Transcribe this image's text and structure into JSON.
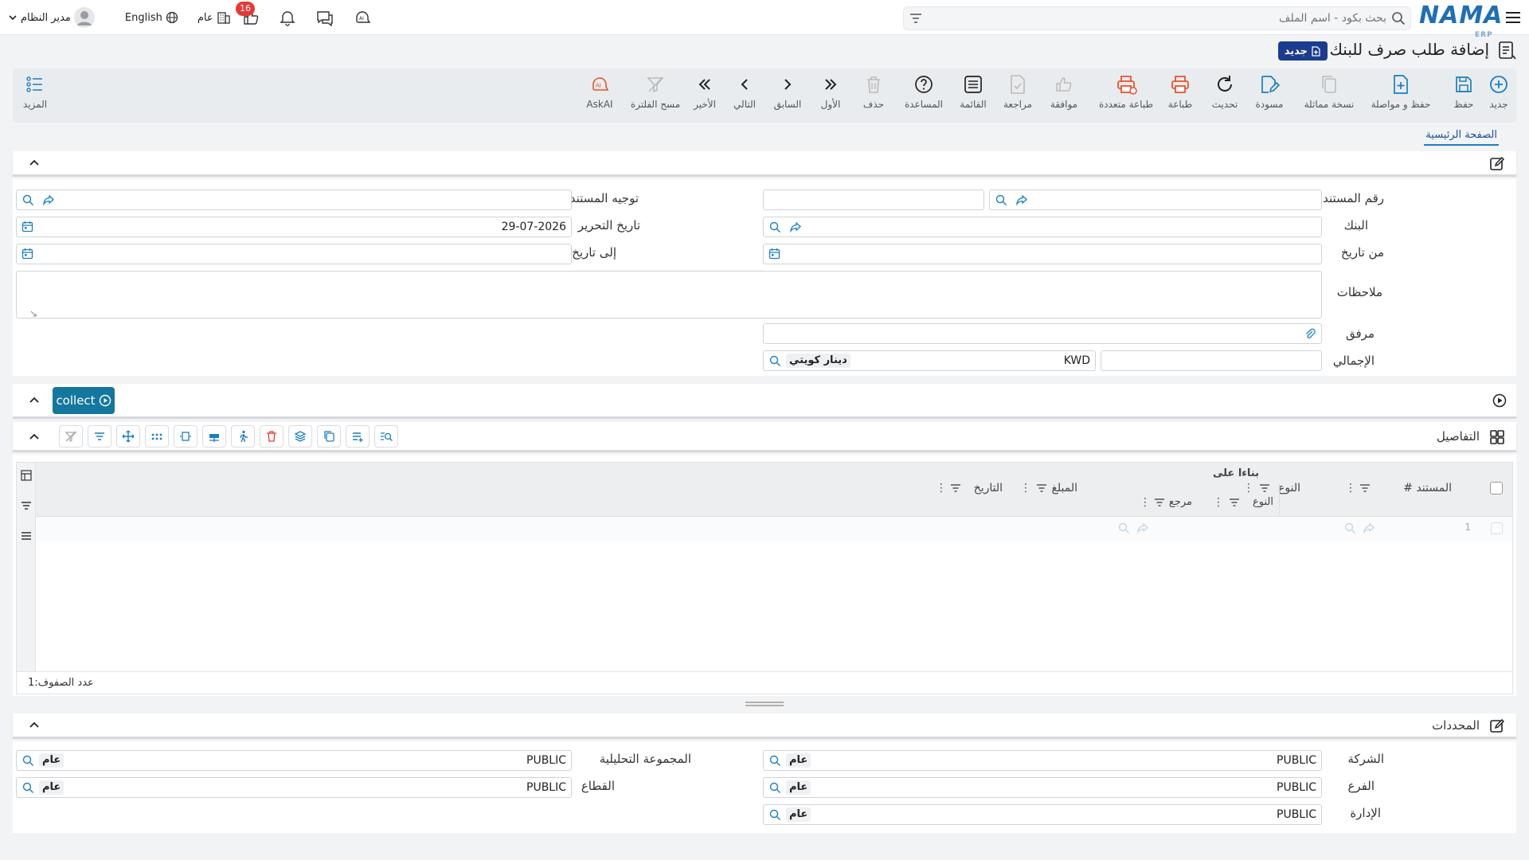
{
  "header": {
    "logo": "NAMA",
    "logo_sub": "ERP",
    "search_placeholder": "بحث بكود - اسم الملف",
    "user_name": "مدير النظام",
    "language": "English",
    "scope": "عام",
    "notification_count": "16"
  },
  "page": {
    "title": "إضافة طلب صرف للبنك",
    "status_tag": "جديد"
  },
  "toolbar": {
    "new": "جديد",
    "save": "حفظ",
    "save_continue": "حفظ و مواصلة",
    "copy": "نسخة مماثلة",
    "draft": "مسودة",
    "refresh": "تحديث",
    "print": "طباعة",
    "multi_print": "طباعة متعددة",
    "approve": "موافقة",
    "review": "مراجعة",
    "list": "القائمة",
    "help": "المساعدة",
    "delete": "حذف",
    "first": "الأول",
    "previous": "السابق",
    "next": "التالي",
    "last": "الأخير",
    "clear_filter": "مسح الفلترة",
    "askai": "AskAI",
    "more": "المزيد"
  },
  "tabs": {
    "home": "الصفحة الرئيسية"
  },
  "main_form": {
    "doc_number_label": "رقم المستند",
    "doc_direction_label": "توجيه المستند",
    "bank_label": "البنك",
    "issue_date_label": "تاريخ التحرير",
    "issue_date_value": "29-07-2026",
    "from_date_label": "من تاريخ",
    "to_date_label": "إلى تاريخ",
    "notes_label": "ملاحظات",
    "attachment_label": "مرفق",
    "total_label": "الإجمالي",
    "currency_code": "KWD",
    "currency_name": "دينار كويتي"
  },
  "collect_button": "collect",
  "details": {
    "title": "التفاصيل",
    "columns": {
      "doc_no": "# المستند",
      "type": "النوع",
      "based_on": "بناءا على",
      "based_on_type": "النوع",
      "reference": "مرجع",
      "amount": "المبلغ",
      "date": "التاريخ"
    },
    "rows": [
      "1"
    ],
    "row_count_label": "عدد الصفوف:",
    "row_count": "1"
  },
  "dimensions": {
    "title": "المحددات",
    "company_label": "الشركة",
    "company_code": "PUBLIC",
    "company_name": "عام",
    "branch_label": "الفرع",
    "branch_code": "PUBLIC",
    "branch_name": "عام",
    "department_label": "الإدارة",
    "department_code": "PUBLIC",
    "department_name": "عام",
    "analytic_label": "المجموعة التحليلية",
    "analytic_code": "PUBLIC",
    "analytic_name": "عام",
    "sector_label": "القطاع",
    "sector_code": "PUBLIC",
    "sector_name": "عام"
  },
  "colors": {
    "accent": "#1a7fc1",
    "collect": "#14779e",
    "status_tag": "#1b3c8f",
    "badge": "#e53935",
    "print_icon": "#e8532b"
  }
}
